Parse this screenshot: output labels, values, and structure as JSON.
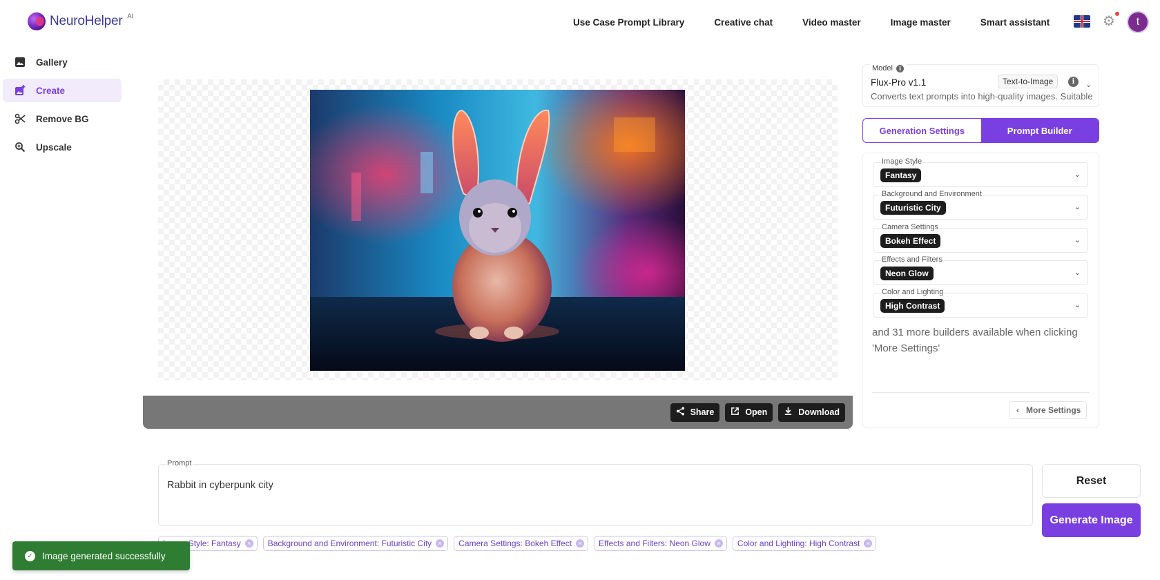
{
  "app": {
    "brand_neuro": "Neuro",
    "brand_helper": "Helper",
    "brand_ai": "AI",
    "avatar_letter": "t"
  },
  "topnav": [
    {
      "label": "Use Case Prompt Library"
    },
    {
      "label": "Creative chat"
    },
    {
      "label": "Video master"
    },
    {
      "label": "Image master"
    },
    {
      "label": "Smart assistant"
    }
  ],
  "sidebar": {
    "items": [
      {
        "label": "Gallery",
        "icon": "image-icon"
      },
      {
        "label": "Create",
        "icon": "add-image-icon",
        "active": true
      },
      {
        "label": "Remove BG",
        "icon": "scissors-icon"
      },
      {
        "label": "Upscale",
        "icon": "zoom-icon"
      }
    ]
  },
  "canvas": {
    "actions": {
      "share": "Share",
      "open": "Open",
      "download": "Download"
    }
  },
  "model": {
    "label": "Model",
    "name": "Flux-Pro v1.1",
    "type": "Text-to-Image",
    "description": "Converts text prompts into high-quality images. Suitable"
  },
  "tabs": {
    "generation": "Generation Settings",
    "builder": "Prompt Builder"
  },
  "builders": [
    {
      "label": "Image Style",
      "value": "Fantasy"
    },
    {
      "label": "Background and Environment",
      "value": "Futuristic City"
    },
    {
      "label": "Camera Settings",
      "value": "Bokeh Effect"
    },
    {
      "label": "Effects and Filters",
      "value": "Neon Glow"
    },
    {
      "label": "Color and Lighting",
      "value": "High Contrast"
    }
  ],
  "builder_note": "and 31 more builders available when clicking 'More Settings'",
  "more_settings": "More Settings",
  "prompt": {
    "label": "Prompt",
    "value": "Rabbit in cyberpunk city",
    "reset": "Reset",
    "generate": "Generate Image"
  },
  "tags": [
    "Image Style: Fantasy",
    "Background and Environment: Futuristic City",
    "Camera Settings: Bokeh Effect",
    "Effects and Filters: Neon Glow",
    "Color and Lighting: High Contrast"
  ],
  "toast": "Image generated successfully",
  "colors": {
    "accent": "#7a3fe0",
    "toast": "#2e7d32"
  }
}
